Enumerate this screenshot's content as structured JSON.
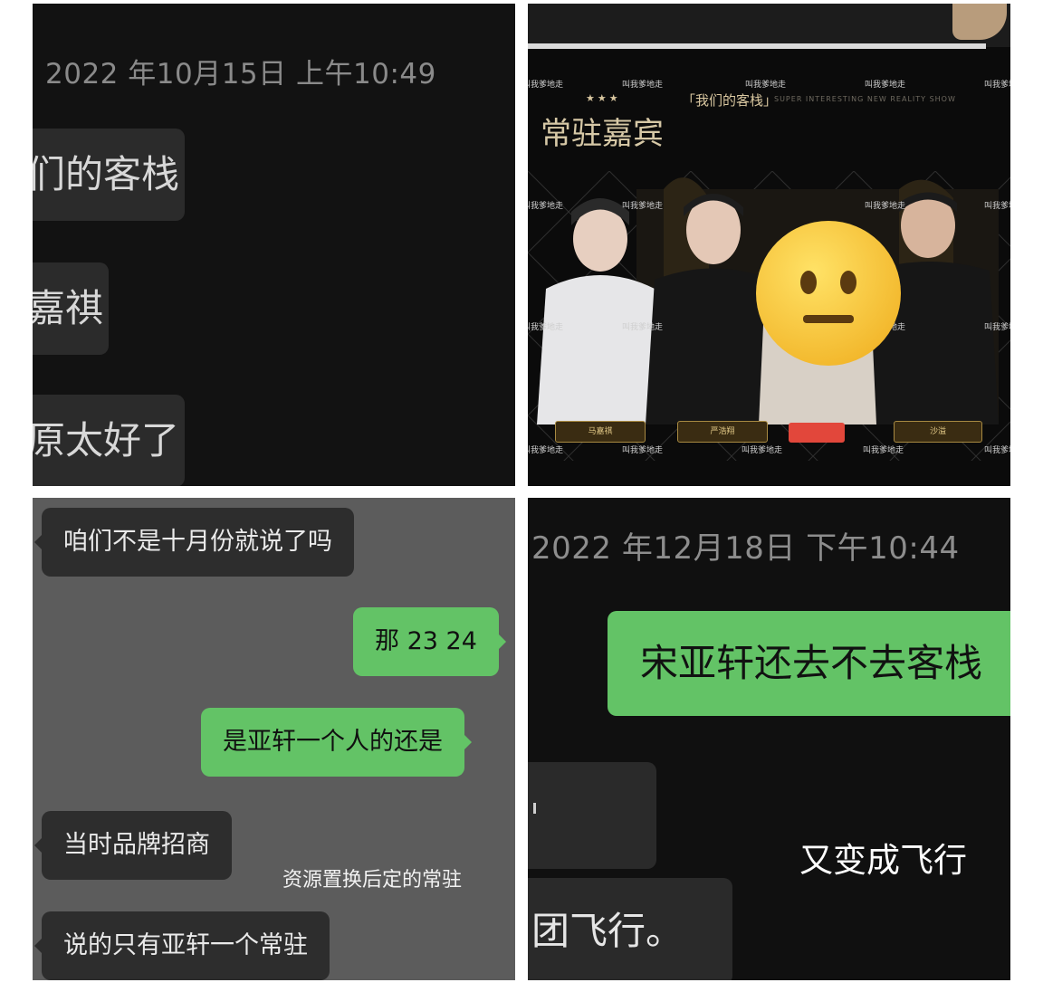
{
  "panel1": {
    "timestamp": "2022 年10月15日 上午10:49",
    "messages": [
      "们的客栈",
      "嘉祺",
      "原太好了"
    ]
  },
  "panel2": {
    "show_name": "「我们的客栈」",
    "subtitle_en": "SUPER INTERESTING NEW REALITY SHOW",
    "heading": "常驻嘉宾",
    "watermark": "叫我爹地走",
    "nameplates": [
      "马嘉祺",
      "严浩翔",
      "沙溢"
    ],
    "emoji": "neutral-face-emoji"
  },
  "panel3": {
    "messages": [
      {
        "side": "left",
        "text": "咱们不是十月份就说了吗"
      },
      {
        "side": "right",
        "text": "那 23 24"
      },
      {
        "side": "right",
        "text": "是亚轩一个人的还是"
      },
      {
        "side": "left",
        "text": "当时品牌招商"
      },
      {
        "side": "left",
        "text": "说的只有亚轩一个常驻"
      }
    ],
    "caption": "资源置换后定的常驻"
  },
  "panel4": {
    "timestamp": "2022 年12月18日 下午10:44",
    "outgoing": "宋亚轩还去不去客栈",
    "incoming_partial": "团飞行。",
    "overlay_text": "又变成飞行"
  },
  "colors": {
    "green_bubble": "#63c366",
    "dark_bubble": "#2b2b2b",
    "timestamp_gray": "#8a8a8a"
  }
}
